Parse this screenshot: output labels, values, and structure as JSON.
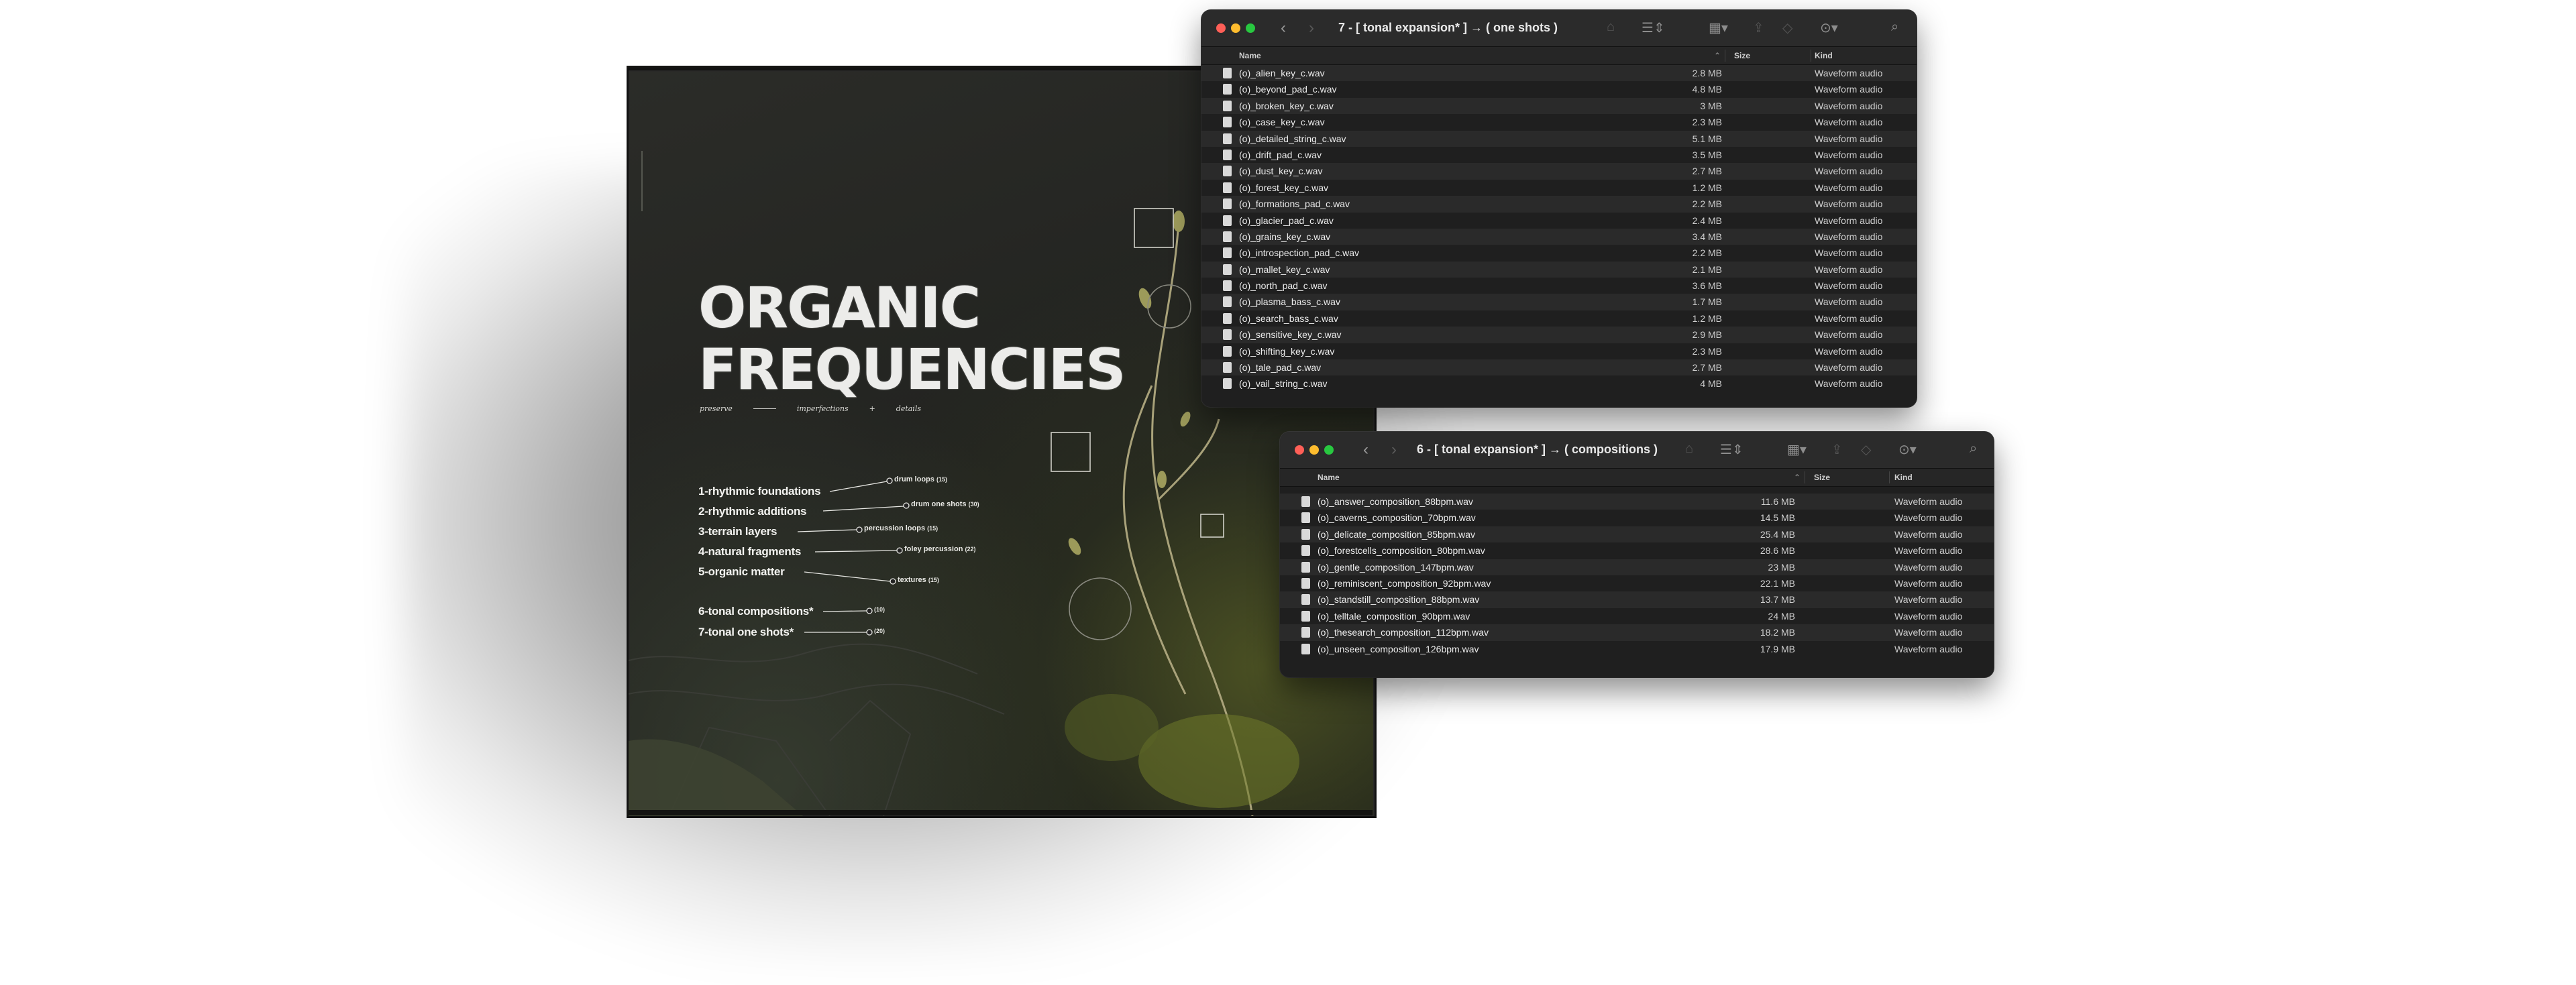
{
  "product": {
    "title_line1": "ORGANIC",
    "title_line2": "FREQUENCIES",
    "tagline": [
      "preserve",
      "imperfections",
      "+",
      "details"
    ],
    "categories": [
      {
        "label": "1-rhythmic foundations",
        "sub": "drum loops",
        "count": "(15)"
      },
      {
        "label": "2-rhythmic additions",
        "sub": "drum one shots",
        "count": "(30)"
      },
      {
        "label": "3-terrain layers",
        "sub": "percussion loops",
        "count": "(15)"
      },
      {
        "label": "4-natural fragments",
        "sub": "foley percussion",
        "count": "(22)"
      },
      {
        "label": "5-organic matter",
        "sub": "textures",
        "count": "(15)"
      },
      {
        "label": "6-tonal compositions*",
        "sub": "",
        "count": "(10)"
      },
      {
        "label": "7-tonal one shots*",
        "sub": "",
        "count": "(20)"
      }
    ]
  },
  "window_one_shots": {
    "title": "7 - [ tonal expansion* ] → ( one shots )",
    "columns": {
      "name": "Name",
      "size": "Size",
      "kind": "Kind"
    },
    "files": [
      {
        "name": "(o)_alien_key_c.wav",
        "size": "2.8 MB",
        "kind": "Waveform audio"
      },
      {
        "name": "(o)_beyond_pad_c.wav",
        "size": "4.8 MB",
        "kind": "Waveform audio"
      },
      {
        "name": "(o)_broken_key_c.wav",
        "size": "3 MB",
        "kind": "Waveform audio"
      },
      {
        "name": "(o)_case_key_c.wav",
        "size": "2.3 MB",
        "kind": "Waveform audio"
      },
      {
        "name": "(o)_detailed_string_c.wav",
        "size": "5.1 MB",
        "kind": "Waveform audio"
      },
      {
        "name": "(o)_drift_pad_c.wav",
        "size": "3.5 MB",
        "kind": "Waveform audio"
      },
      {
        "name": "(o)_dust_key_c.wav",
        "size": "2.7 MB",
        "kind": "Waveform audio"
      },
      {
        "name": "(o)_forest_key_c.wav",
        "size": "1.2 MB",
        "kind": "Waveform audio"
      },
      {
        "name": "(o)_formations_pad_c.wav",
        "size": "2.2 MB",
        "kind": "Waveform audio"
      },
      {
        "name": "(o)_glacier_pad_c.wav",
        "size": "2.4 MB",
        "kind": "Waveform audio"
      },
      {
        "name": "(o)_grains_key_c.wav",
        "size": "3.4 MB",
        "kind": "Waveform audio"
      },
      {
        "name": "(o)_introspection_pad_c.wav",
        "size": "2.2 MB",
        "kind": "Waveform audio"
      },
      {
        "name": "(o)_mallet_key_c.wav",
        "size": "2.1 MB",
        "kind": "Waveform audio"
      },
      {
        "name": "(o)_north_pad_c.wav",
        "size": "3.6 MB",
        "kind": "Waveform audio"
      },
      {
        "name": "(o)_plasma_bass_c.wav",
        "size": "1.7 MB",
        "kind": "Waveform audio"
      },
      {
        "name": "(o)_search_bass_c.wav",
        "size": "1.2 MB",
        "kind": "Waveform audio"
      },
      {
        "name": "(o)_sensitive_key_c.wav",
        "size": "2.9 MB",
        "kind": "Waveform audio"
      },
      {
        "name": "(o)_shifting_key_c.wav",
        "size": "2.3 MB",
        "kind": "Waveform audio"
      },
      {
        "name": "(o)_tale_pad_c.wav",
        "size": "2.7 MB",
        "kind": "Waveform audio"
      },
      {
        "name": "(o)_vail_string_c.wav",
        "size": "4 MB",
        "kind": "Waveform audio"
      }
    ]
  },
  "window_compositions": {
    "title": "6 - [ tonal expansion* ] → ( compositions )",
    "columns": {
      "name": "Name",
      "size": "Size",
      "kind": "Kind"
    },
    "files": [
      {
        "name": "(o)_answer_composition_88bpm.wav",
        "size": "11.6 MB",
        "kind": "Waveform audio"
      },
      {
        "name": "(o)_caverns_composition_70bpm.wav",
        "size": "14.5 MB",
        "kind": "Waveform audio"
      },
      {
        "name": "(o)_delicate_composition_85bpm.wav",
        "size": "25.4 MB",
        "kind": "Waveform audio"
      },
      {
        "name": "(o)_forestcells_composition_80bpm.wav",
        "size": "28.6 MB",
        "kind": "Waveform audio"
      },
      {
        "name": "(o)_gentle_composition_147bpm.wav",
        "size": "23 MB",
        "kind": "Waveform audio"
      },
      {
        "name": "(o)_reminiscent_composition_92bpm.wav",
        "size": "22.1 MB",
        "kind": "Waveform audio"
      },
      {
        "name": "(o)_standstill_composition_88bpm.wav",
        "size": "13.7 MB",
        "kind": "Waveform audio"
      },
      {
        "name": "(o)_telltale_composition_90bpm.wav",
        "size": "24 MB",
        "kind": "Waveform audio"
      },
      {
        "name": "(o)_thesearch_composition_112bpm.wav",
        "size": "18.2 MB",
        "kind": "Waveform audio"
      },
      {
        "name": "(o)_unseen_composition_126bpm.wav",
        "size": "17.9 MB",
        "kind": "Waveform audio"
      }
    ]
  },
  "toolbar_icons": [
    "chevron-left-icon",
    "chevron-right-icon",
    "folder-icon",
    "list-view-icon",
    "grid-view-icon",
    "share-icon",
    "tag-icon",
    "more-icon",
    "search-icon"
  ],
  "colors": {
    "finder_bg": "#1f1f1f",
    "titlebar": "#2b2b2b",
    "traffic_red": "#ff5f57",
    "traffic_yellow": "#febc2e",
    "traffic_green": "#28c840"
  }
}
